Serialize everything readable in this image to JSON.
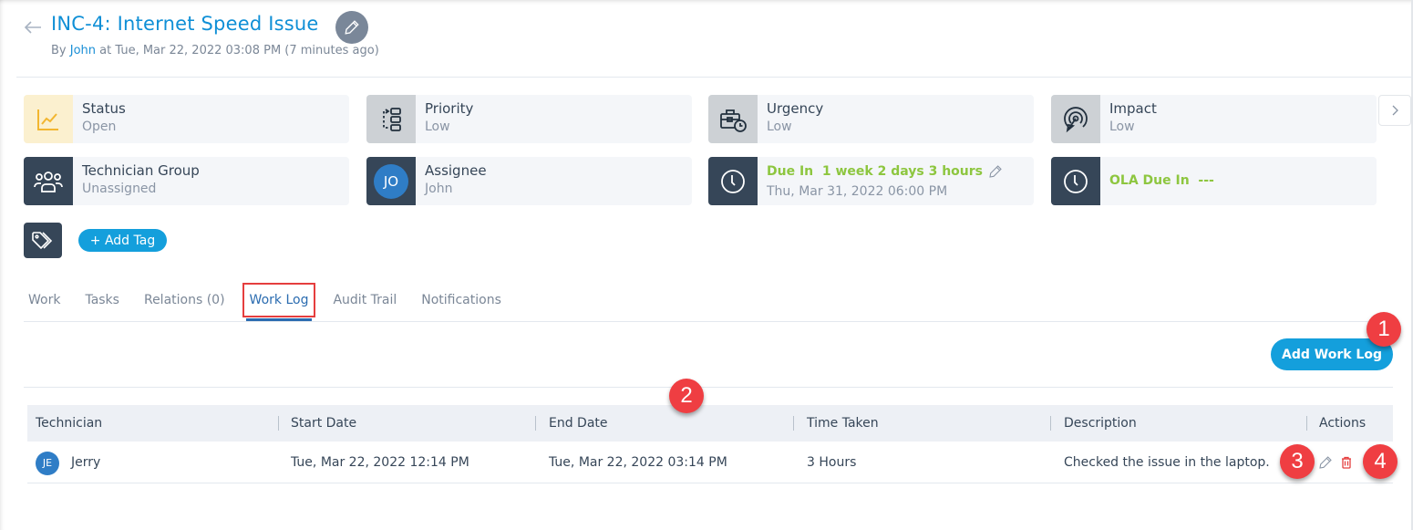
{
  "header": {
    "title": "INC-4: Internet Speed Issue",
    "subtitle_prefix": "By ",
    "created_by": "John",
    "subtitle_suffix": " at Tue, Mar 22, 2022 03:08 PM (7 minutes ago)"
  },
  "cards": {
    "status": {
      "label": "Status",
      "value": "Open",
      "icon": "chart-line-icon"
    },
    "priority": {
      "label": "Priority",
      "value": "Low",
      "icon": "flow-blocks-icon"
    },
    "urgency": {
      "label": "Urgency",
      "value": "Low",
      "icon": "briefcase-clock-icon"
    },
    "impact": {
      "label": "Impact",
      "value": "Low",
      "icon": "target-cursor-icon"
    },
    "technician_group": {
      "label": "Technician Group",
      "value": "Unassigned",
      "icon": "users-icon"
    },
    "assignee": {
      "label": "Assignee",
      "value": "John",
      "initials": "JO"
    },
    "due": {
      "label": "Due In  1 week 2 days 3 hours",
      "value": "Thu, Mar 31, 2022 06:00 PM",
      "icon": "clock-icon"
    },
    "ola_due": {
      "label": "OLA Due In  ---",
      "icon": "clock-icon"
    }
  },
  "tags": {
    "add_tag_label": "+ Add Tag"
  },
  "tabs": [
    {
      "label": "Work",
      "active": false
    },
    {
      "label": "Tasks",
      "active": false
    },
    {
      "label": "Relations (0)",
      "active": false
    },
    {
      "label": "Work Log",
      "active": true
    },
    {
      "label": "Audit Trail",
      "active": false
    },
    {
      "label": "Notifications",
      "active": false
    }
  ],
  "worklog": {
    "add_button_label": "Add Work Log",
    "columns": [
      "Technician",
      "Start Date",
      "End Date",
      "Time Taken",
      "Description",
      "Actions"
    ],
    "rows": [
      {
        "technician": "Jerry",
        "initials": "JE",
        "start_date": "Tue, Mar 22, 2022 12:14 PM",
        "end_date": "Tue, Mar 22, 2022 03:14 PM",
        "time_taken": "3 Hours",
        "description": "Checked the issue in the laptop."
      }
    ]
  },
  "callouts": [
    "1",
    "2",
    "3",
    "4"
  ],
  "colors": {
    "accent": "#149fdc",
    "title": "#0f8fd6",
    "due_green": "#8dc63f",
    "callout_red": "#ef3e42",
    "delete_red": "#e53e3e",
    "dark_icon_bg": "#364658"
  }
}
